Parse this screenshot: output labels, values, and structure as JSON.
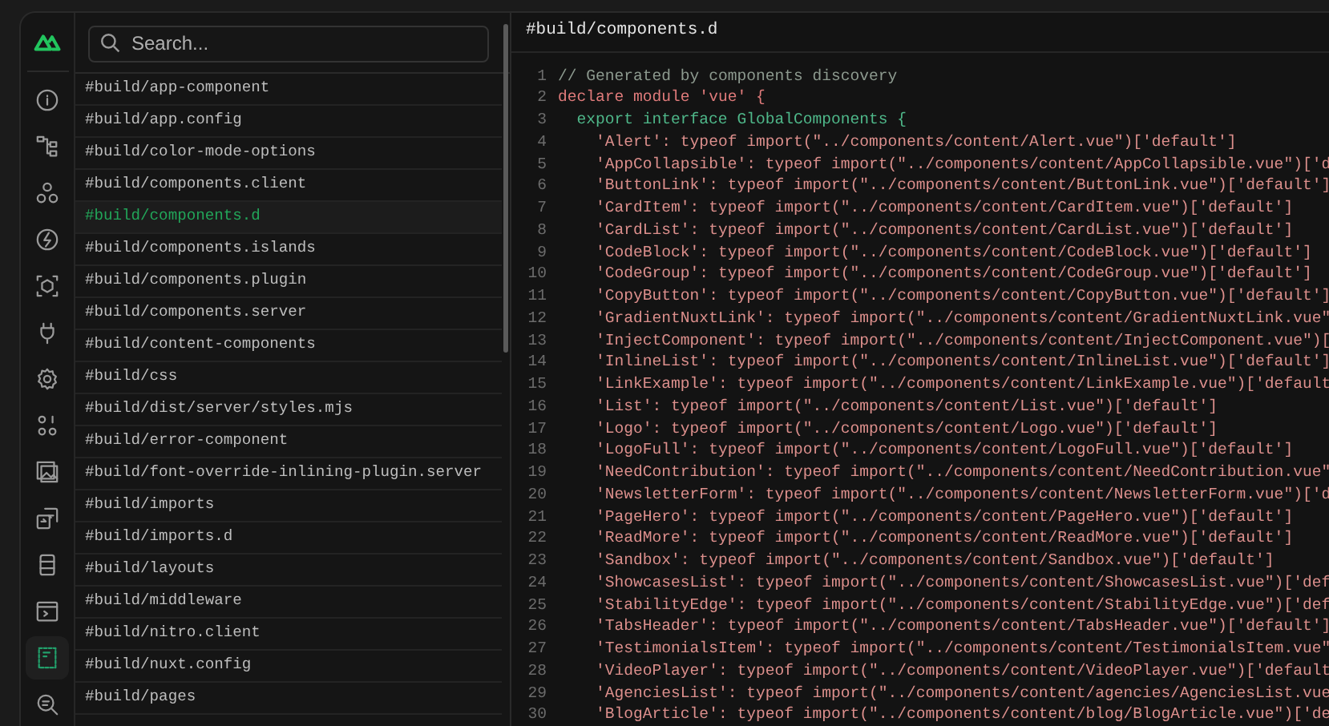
{
  "rail_items": [
    {
      "kind": "info",
      "selected": false
    },
    {
      "kind": "tree",
      "selected": false
    },
    {
      "kind": "circles",
      "selected": false
    },
    {
      "kind": "bolt",
      "selected": false
    },
    {
      "kind": "cube",
      "selected": false
    },
    {
      "kind": "plug",
      "selected": false
    },
    {
      "kind": "gear",
      "selected": false
    },
    {
      "kind": "dots",
      "selected": false
    },
    {
      "kind": "image",
      "selected": false
    },
    {
      "kind": "swap",
      "selected": false
    },
    {
      "kind": "database",
      "selected": false
    },
    {
      "kind": "terminal",
      "selected": false
    },
    {
      "kind": "file",
      "selected": true
    },
    {
      "kind": "search",
      "selected": false
    }
  ],
  "search": {
    "placeholder": "Search..."
  },
  "files": [
    {
      "label": "#build/app-component",
      "selected": false
    },
    {
      "label": "#build/app.config",
      "selected": false
    },
    {
      "label": "#build/color-mode-options",
      "selected": false
    },
    {
      "label": "#build/components.client",
      "selected": false
    },
    {
      "label": "#build/components.d",
      "selected": true
    },
    {
      "label": "#build/components.islands",
      "selected": false
    },
    {
      "label": "#build/components.plugin",
      "selected": false
    },
    {
      "label": "#build/components.server",
      "selected": false
    },
    {
      "label": "#build/content-components",
      "selected": false
    },
    {
      "label": "#build/css",
      "selected": false
    },
    {
      "label": "#build/dist/server/styles.mjs",
      "selected": false
    },
    {
      "label": "#build/error-component",
      "selected": false
    },
    {
      "label": "#build/font-override-inlining-plugin.server",
      "selected": false
    },
    {
      "label": "#build/imports",
      "selected": false
    },
    {
      "label": "#build/imports.d",
      "selected": false
    },
    {
      "label": "#build/layouts",
      "selected": false
    },
    {
      "label": "#build/middleware",
      "selected": false
    },
    {
      "label": "#build/nitro.client",
      "selected": false
    },
    {
      "label": "#build/nuxt.config",
      "selected": false
    },
    {
      "label": "#build/pages",
      "selected": false
    }
  ],
  "editor": {
    "title": "#build/components.d",
    "lines": [
      {
        "number": "1",
        "kind": "comment",
        "text": "// Generated by components discovery"
      },
      {
        "number": "2",
        "kind": "declare",
        "text": "declare module 'vue' {"
      },
      {
        "number": "3",
        "kind": "export",
        "text": "export interface GlobalComponents {"
      },
      {
        "number": "4",
        "kind": "entry",
        "text": "'Alert': typeof import(\"../components/content/Alert.vue\")['default']"
      },
      {
        "number": "5",
        "kind": "entry",
        "text": "'AppCollapsible': typeof import(\"../components/content/AppCollapsible.vue\")['d"
      },
      {
        "number": "6",
        "kind": "entry",
        "text": "'ButtonLink': typeof import(\"../components/content/ButtonLink.vue\")['default']"
      },
      {
        "number": "7",
        "kind": "entry",
        "text": "'CardItem': typeof import(\"../components/content/CardItem.vue\")['default']"
      },
      {
        "number": "8",
        "kind": "entry",
        "text": "'CardList': typeof import(\"../components/content/CardList.vue\")['default']"
      },
      {
        "number": "9",
        "kind": "entry",
        "text": "'CodeBlock': typeof import(\"../components/content/CodeBlock.vue\")['default']"
      },
      {
        "number": "10",
        "kind": "entry",
        "text": "'CodeGroup': typeof import(\"../components/content/CodeGroup.vue\")['default']"
      },
      {
        "number": "11",
        "kind": "entry",
        "text": "'CopyButton': typeof import(\"../components/content/CopyButton.vue\")['default']"
      },
      {
        "number": "12",
        "kind": "entry",
        "text": "'GradientNuxtLink': typeof import(\"../components/content/GradientNuxtLink.vue\""
      },
      {
        "number": "13",
        "kind": "entry",
        "text": "'InjectComponent': typeof import(\"../components/content/InjectComponent.vue\")["
      },
      {
        "number": "14",
        "kind": "entry",
        "text": "'InlineList': typeof import(\"../components/content/InlineList.vue\")['default']"
      },
      {
        "number": "15",
        "kind": "entry",
        "text": "'LinkExample': typeof import(\"../components/content/LinkExample.vue\")['default"
      },
      {
        "number": "16",
        "kind": "entry",
        "text": "'List': typeof import(\"../components/content/List.vue\")['default']"
      },
      {
        "number": "17",
        "kind": "entry",
        "text": "'Logo': typeof import(\"../components/content/Logo.vue\")['default']"
      },
      {
        "number": "18",
        "kind": "entry",
        "text": "'LogoFull': typeof import(\"../components/content/LogoFull.vue\")['default']"
      },
      {
        "number": "19",
        "kind": "entry",
        "text": "'NeedContribution': typeof import(\"../components/content/NeedContribution.vue\""
      },
      {
        "number": "20",
        "kind": "entry",
        "text": "'NewsletterForm': typeof import(\"../components/content/NewsletterForm.vue\")['d"
      },
      {
        "number": "21",
        "kind": "entry",
        "text": "'PageHero': typeof import(\"../components/content/PageHero.vue\")['default']"
      },
      {
        "number": "22",
        "kind": "entry",
        "text": "'ReadMore': typeof import(\"../components/content/ReadMore.vue\")['default']"
      },
      {
        "number": "23",
        "kind": "entry",
        "text": "'Sandbox': typeof import(\"../components/content/Sandbox.vue\")['default']"
      },
      {
        "number": "24",
        "kind": "entry",
        "text": "'ShowcasesList': typeof import(\"../components/content/ShowcasesList.vue\")['def"
      },
      {
        "number": "25",
        "kind": "entry",
        "text": "'StabilityEdge': typeof import(\"../components/content/StabilityEdge.vue\")['def"
      },
      {
        "number": "26",
        "kind": "entry",
        "text": "'TabsHeader': typeof import(\"../components/content/TabsHeader.vue\")['default']"
      },
      {
        "number": "27",
        "kind": "entry",
        "text": "'TestimonialsItem': typeof import(\"../components/content/TestimonialsItem.vue\""
      },
      {
        "number": "28",
        "kind": "entry",
        "text": "'VideoPlayer': typeof import(\"../components/content/VideoPlayer.vue\")['default"
      },
      {
        "number": "29",
        "kind": "entry",
        "text": "'AgenciesList': typeof import(\"../components/content/agencies/AgenciesList.vue"
      },
      {
        "number": "30",
        "kind": "entry",
        "text": "'BlogArticle': typeof import(\"../components/content/blog/BlogArticle.vue\")['de"
      }
    ]
  }
}
